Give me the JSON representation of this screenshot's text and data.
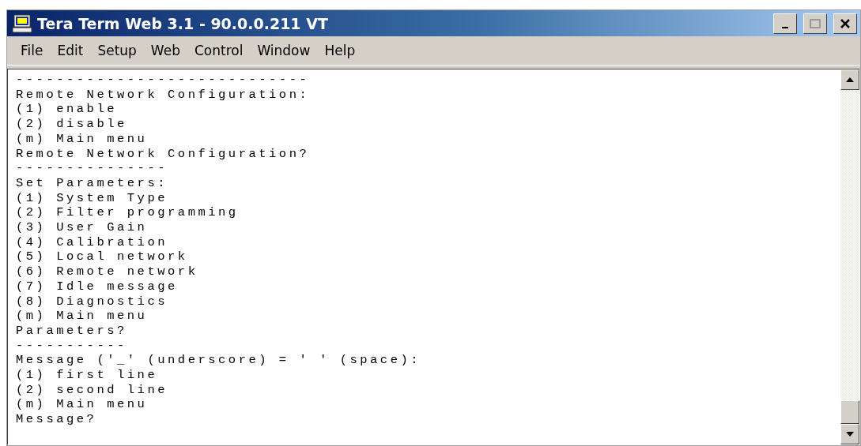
{
  "window": {
    "title": "Tera Term Web 3.1 - 90.0.0.211 VT"
  },
  "menu": [
    "File",
    "Edit",
    "Setup",
    "Web",
    "Control",
    "Window",
    "Help"
  ],
  "terminal": {
    "lines": [
      "-----------------------------",
      "Remote Network Configuration:",
      "(1) enable",
      "(2) disable",
      "(m) Main menu",
      "Remote Network Configuration?",
      "---------------",
      "Set Parameters:",
      "(1) System Type",
      "(2) Filter programming",
      "(3) User Gain",
      "(4) Calibration",
      "(5) Local network",
      "(6) Remote network",
      "(7) Idle message",
      "(8) Diagnostics",
      "(m) Main menu",
      "Parameters?",
      "-----------",
      "Message ('_' (underscore) = ' ' (space):",
      "(1) first line",
      "(2) second line",
      "(m) Main menu",
      "Message?"
    ]
  }
}
